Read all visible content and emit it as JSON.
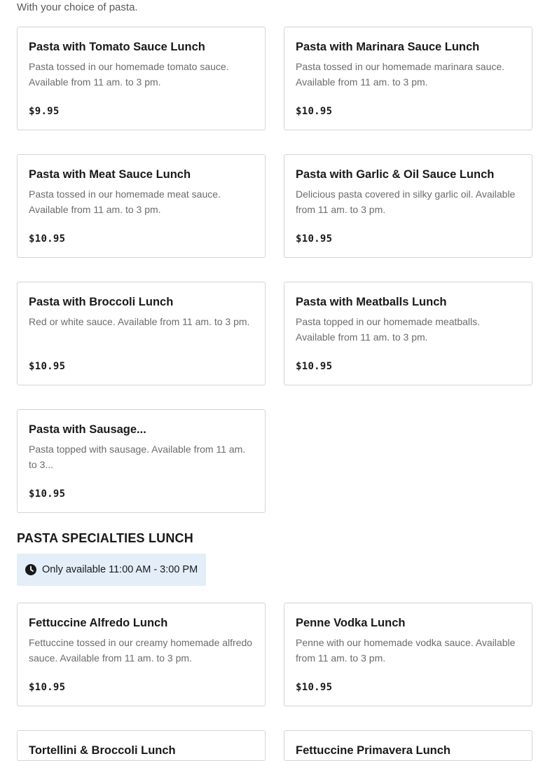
{
  "pasta_section": {
    "subtitle": "With your choice of pasta."
  },
  "cards_top": [
    {
      "title": "Pasta with Tomato Sauce Lunch",
      "desc": "Pasta tossed in our homemade tomato sauce. Available from 11 am. to 3 pm.",
      "price": "$9.95"
    },
    {
      "title": "Pasta with Marinara Sauce Lunch",
      "desc": "Pasta tossed in our homemade marinara sauce. Available from 11 am. to 3 pm.",
      "price": "$10.95"
    },
    {
      "title": "Pasta with Meat Sauce Lunch",
      "desc": "Pasta tossed in our homemade meat sauce. Available from 11 am. to 3 pm.",
      "price": "$10.95"
    },
    {
      "title": "Pasta with Garlic & Oil Sauce Lunch",
      "desc": "Delicious pasta covered in silky garlic oil. Available from 11 am. to 3 pm.",
      "price": "$10.95"
    },
    {
      "title": "Pasta with Broccoli Lunch",
      "desc": "Red or white sauce. Available from 11 am. to 3 pm.",
      "price": "$10.95"
    },
    {
      "title": "Pasta with Meatballs Lunch",
      "desc": "Pasta topped in our homemade meatballs. Available from 11 am. to 3 pm.",
      "price": "$10.95"
    },
    {
      "title": "Pasta with Sausage...",
      "desc": "Pasta topped with sausage. Available from 11 am. to 3...",
      "price": "$10.95"
    }
  ],
  "specialties": {
    "heading": "PASTA SPECIALTIES LUNCH",
    "availability": "Only available 11:00 AM - 3:00 PM",
    "cards": [
      {
        "title": "Fettuccine Alfredo Lunch",
        "desc": "Fettuccine tossed in our creamy homemade alfredo sauce. Available from 11 am. to 3 pm.",
        "price": "$10.95"
      },
      {
        "title": "Penne Vodka Lunch",
        "desc": "Penne with our homemade vodka sauce. Available from 11 am. to 3 pm.",
        "price": "$10.95"
      },
      {
        "title": "Tortellini & Broccoli Lunch",
        "desc": "",
        "price": ""
      },
      {
        "title": "Fettuccine Primavera Lunch",
        "desc": "",
        "price": ""
      }
    ]
  },
  "icons": {
    "clock": "clock-icon"
  }
}
